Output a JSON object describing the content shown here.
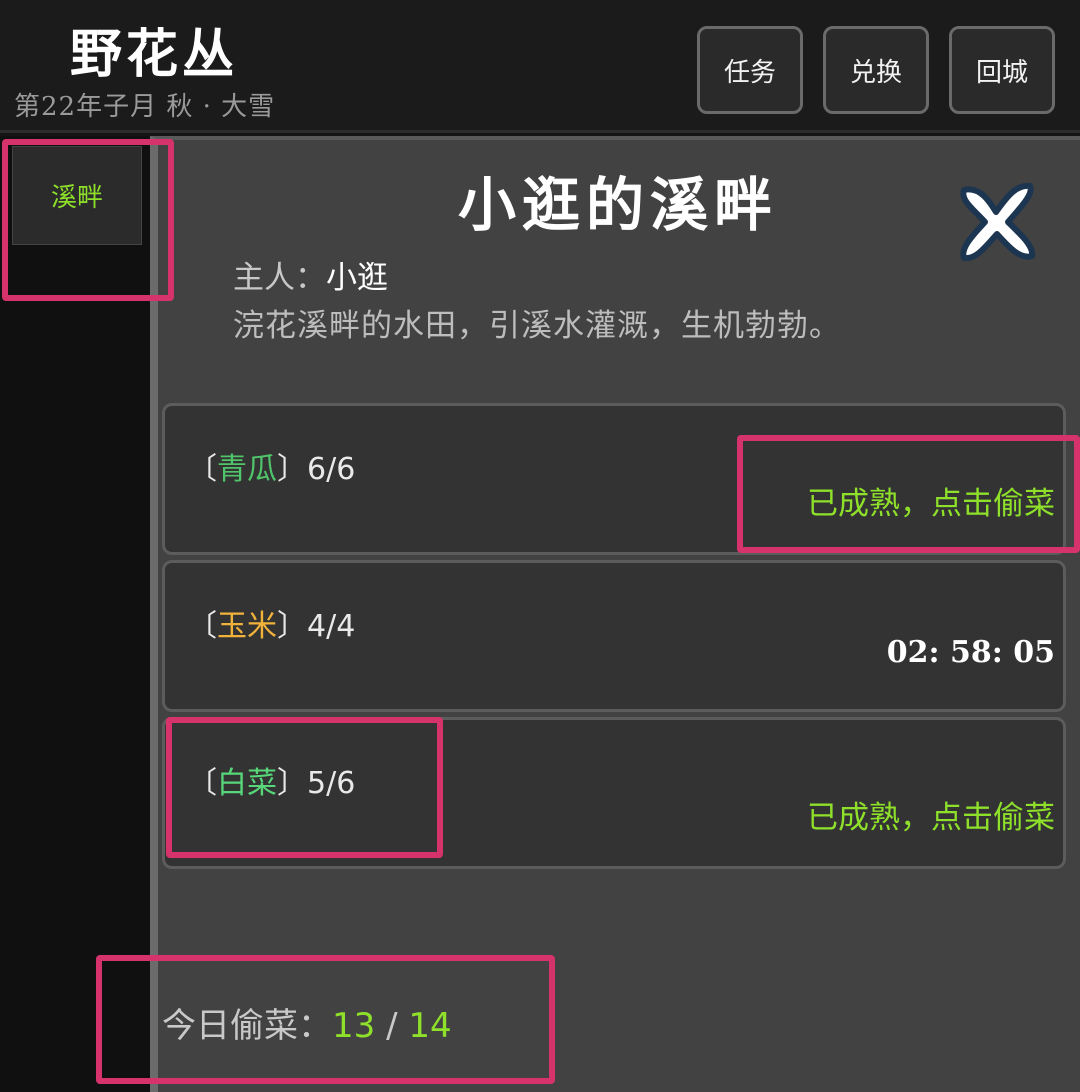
{
  "header": {
    "title": "野花丛",
    "date": "第22年子月 秋 · 大雪",
    "buttons": {
      "task": "任务",
      "exchange": "兑换",
      "return": "回城"
    }
  },
  "sidebar": {
    "tab": "溪畔"
  },
  "panel": {
    "title": "小逛的溪畔",
    "owner_label": "主人：",
    "owner_name": "小逛",
    "description": "浣花溪畔的水田，引溪水灌溉，生机勃勃。",
    "close_icon": "close-x-icon"
  },
  "plots": [
    {
      "open": "〔",
      "crop": "青瓜",
      "close": "〕",
      "count": "6/6",
      "status": "已成熟，点击偷菜",
      "color": "#4fc46a"
    },
    {
      "open": "〔",
      "crop": "玉米",
      "close": "〕",
      "count": "4/4",
      "timer": "02: 58: 05",
      "color": "#f0b23a"
    },
    {
      "open": "〔",
      "crop": "白菜",
      "close": "〕",
      "count": "5/6",
      "status": "已成熟，点击偷菜",
      "color": "#58d67a"
    }
  ],
  "today": {
    "label": "今日偷菜：",
    "current": "13",
    "sep": " / ",
    "max": "14"
  },
  "highlight_color": "#d6336c"
}
